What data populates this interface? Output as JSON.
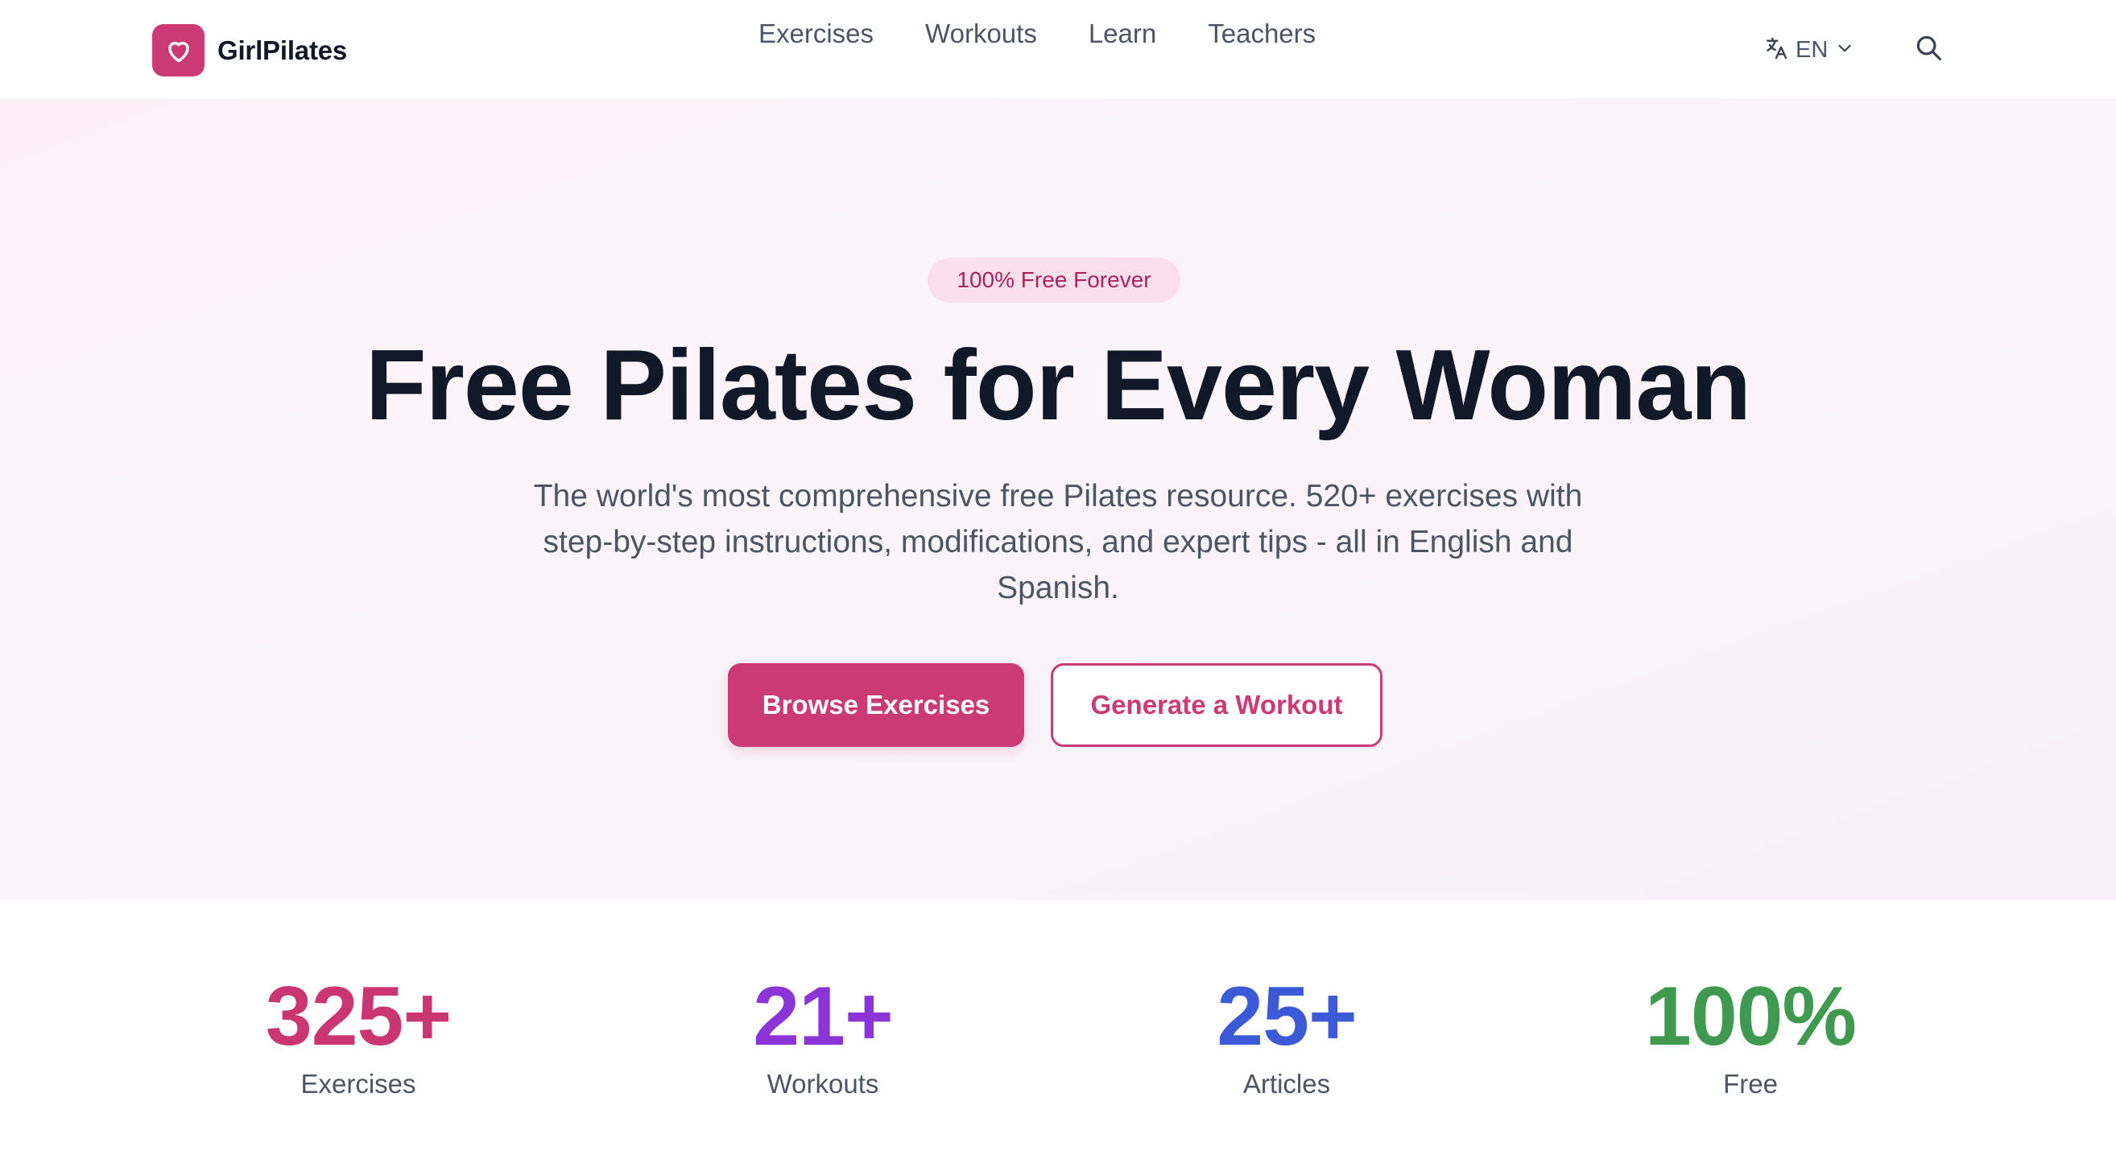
{
  "brand": {
    "name": "GirlPilates",
    "logo_icon": "heart-icon"
  },
  "nav": {
    "items": [
      {
        "label": "Exercises"
      },
      {
        "label": "Workouts"
      },
      {
        "label": "Learn"
      },
      {
        "label": "Teachers"
      }
    ]
  },
  "language": {
    "icon": "translate-icon",
    "current": "EN"
  },
  "search": {
    "icon": "search-icon"
  },
  "hero": {
    "badge": "100% Free Forever",
    "title": "Free Pilates for Every Woman",
    "subtitle": "The world's most comprehensive free Pilates resource. 520+ exercises with step-by-step instructions, modifications, and expert tips - all in English and Spanish.",
    "primary_cta": "Browse Exercises",
    "secondary_cta": "Generate a Workout"
  },
  "stats": [
    {
      "value": "325+",
      "label": "Exercises",
      "color": "#c93672"
    },
    {
      "value": "21+",
      "label": "Workouts",
      "color": "#8c35d6"
    },
    {
      "value": "25+",
      "label": "Articles",
      "color": "#3a5ad8"
    },
    {
      "value": "100%",
      "label": "Free",
      "color": "#3f9a4f"
    }
  ],
  "colors": {
    "accent": "#cc3a76",
    "badge_bg": "#fbe0ec",
    "text_primary": "#111827",
    "text_secondary": "#4b5563"
  }
}
